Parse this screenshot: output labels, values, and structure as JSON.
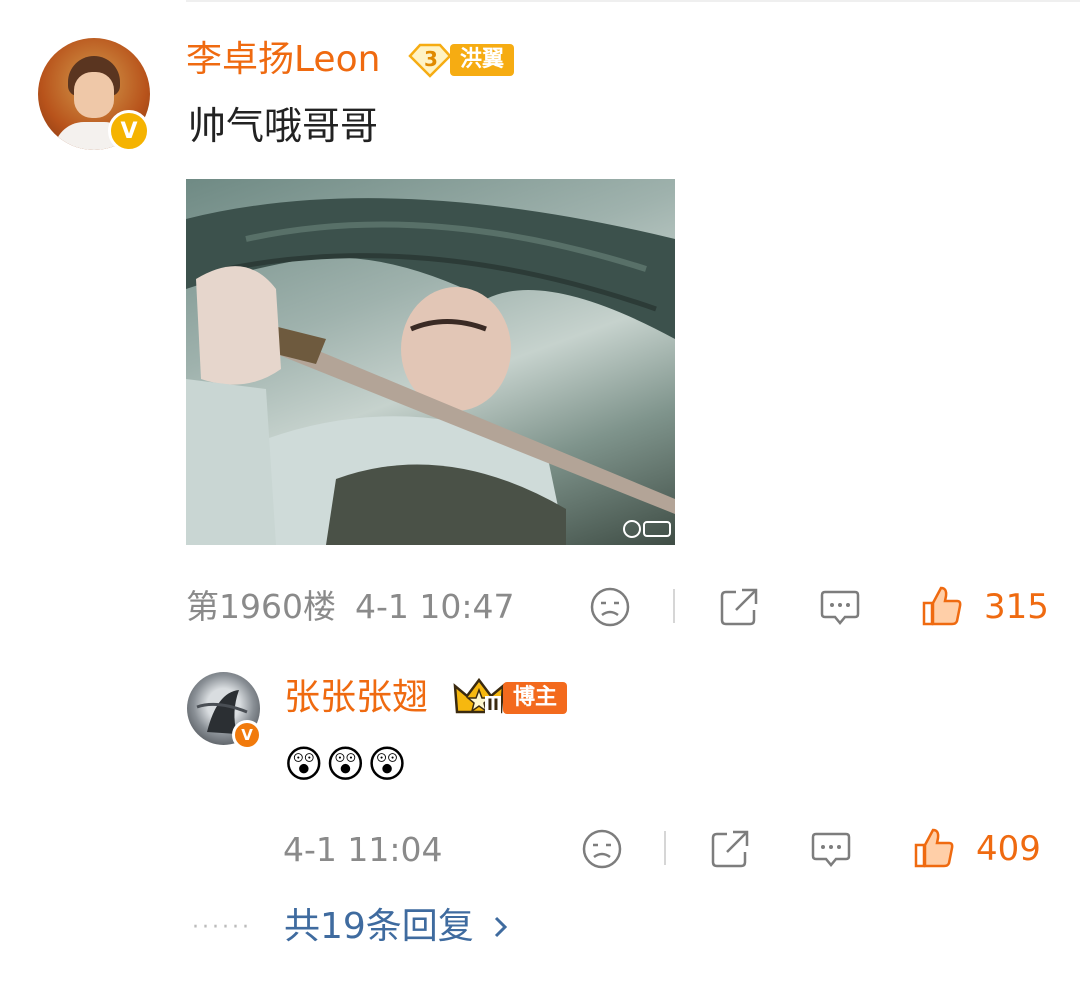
{
  "comment": {
    "username": "李卓扬Leon",
    "level_badge": "洪翼",
    "level_number": "3",
    "text": "帅气哦哥哥",
    "image_alt_watermark": "",
    "floor": "第1960楼",
    "time": "4-1 10:47",
    "likes": "315"
  },
  "reply": {
    "username": "张张张翅",
    "role_badge": "博主",
    "crown_level": "II",
    "emojis": [
      "😲",
      "😲",
      "😲"
    ],
    "time": "4-1 11:04",
    "likes": "409"
  },
  "footer": {
    "more_replies": "共19条回复",
    "dots": "······"
  },
  "colors": {
    "accent": "#ef6a10",
    "link": "#3f6b9f",
    "meta": "#8a8a8a",
    "verify": "#f5b301"
  },
  "icons": [
    "verified-v-icon",
    "sad-face-icon",
    "share-icon",
    "comment-icon",
    "thumbs-up-icon",
    "chevron-right-icon",
    "crown-icon"
  ]
}
